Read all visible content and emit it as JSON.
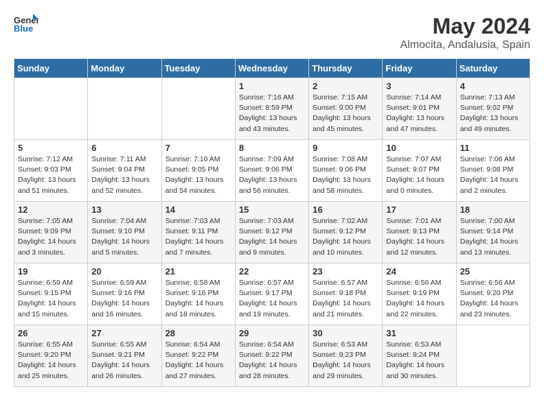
{
  "header": {
    "logo_general": "General",
    "logo_blue": "Blue",
    "title": "May 2024",
    "subtitle": "Almocita, Andalusia, Spain"
  },
  "days_of_week": [
    "Sunday",
    "Monday",
    "Tuesday",
    "Wednesday",
    "Thursday",
    "Friday",
    "Saturday"
  ],
  "weeks": [
    [
      {
        "day": "",
        "info": ""
      },
      {
        "day": "",
        "info": ""
      },
      {
        "day": "",
        "info": ""
      },
      {
        "day": "1",
        "info": "Sunrise: 7:16 AM\nSunset: 8:59 PM\nDaylight: 13 hours\nand 43 minutes."
      },
      {
        "day": "2",
        "info": "Sunrise: 7:15 AM\nSunset: 9:00 PM\nDaylight: 13 hours\nand 45 minutes."
      },
      {
        "day": "3",
        "info": "Sunrise: 7:14 AM\nSunset: 9:01 PM\nDaylight: 13 hours\nand 47 minutes."
      },
      {
        "day": "4",
        "info": "Sunrise: 7:13 AM\nSunset: 9:02 PM\nDaylight: 13 hours\nand 49 minutes."
      }
    ],
    [
      {
        "day": "5",
        "info": "Sunrise: 7:12 AM\nSunset: 9:03 PM\nDaylight: 13 hours\nand 51 minutes."
      },
      {
        "day": "6",
        "info": "Sunrise: 7:11 AM\nSunset: 9:04 PM\nDaylight: 13 hours\nand 52 minutes."
      },
      {
        "day": "7",
        "info": "Sunrise: 7:10 AM\nSunset: 9:05 PM\nDaylight: 13 hours\nand 54 minutes."
      },
      {
        "day": "8",
        "info": "Sunrise: 7:09 AM\nSunset: 9:06 PM\nDaylight: 13 hours\nand 56 minutes."
      },
      {
        "day": "9",
        "info": "Sunrise: 7:08 AM\nSunset: 9:06 PM\nDaylight: 13 hours\nand 58 minutes."
      },
      {
        "day": "10",
        "info": "Sunrise: 7:07 AM\nSunset: 9:07 PM\nDaylight: 14 hours\nand 0 minutes."
      },
      {
        "day": "11",
        "info": "Sunrise: 7:06 AM\nSunset: 9:08 PM\nDaylight: 14 hours\nand 2 minutes."
      }
    ],
    [
      {
        "day": "12",
        "info": "Sunrise: 7:05 AM\nSunset: 9:09 PM\nDaylight: 14 hours\nand 3 minutes."
      },
      {
        "day": "13",
        "info": "Sunrise: 7:04 AM\nSunset: 9:10 PM\nDaylight: 14 hours\nand 5 minutes."
      },
      {
        "day": "14",
        "info": "Sunrise: 7:03 AM\nSunset: 9:11 PM\nDaylight: 14 hours\nand 7 minutes."
      },
      {
        "day": "15",
        "info": "Sunrise: 7:03 AM\nSunset: 9:12 PM\nDaylight: 14 hours\nand 9 minutes."
      },
      {
        "day": "16",
        "info": "Sunrise: 7:02 AM\nSunset: 9:12 PM\nDaylight: 14 hours\nand 10 minutes."
      },
      {
        "day": "17",
        "info": "Sunrise: 7:01 AM\nSunset: 9:13 PM\nDaylight: 14 hours\nand 12 minutes."
      },
      {
        "day": "18",
        "info": "Sunrise: 7:00 AM\nSunset: 9:14 PM\nDaylight: 14 hours\nand 13 minutes."
      }
    ],
    [
      {
        "day": "19",
        "info": "Sunrise: 6:59 AM\nSunset: 9:15 PM\nDaylight: 14 hours\nand 15 minutes."
      },
      {
        "day": "20",
        "info": "Sunrise: 6:59 AM\nSunset: 9:16 PM\nDaylight: 14 hours\nand 16 minutes."
      },
      {
        "day": "21",
        "info": "Sunrise: 6:58 AM\nSunset: 9:16 PM\nDaylight: 14 hours\nand 18 minutes."
      },
      {
        "day": "22",
        "info": "Sunrise: 6:57 AM\nSunset: 9:17 PM\nDaylight: 14 hours\nand 19 minutes."
      },
      {
        "day": "23",
        "info": "Sunrise: 6:57 AM\nSunset: 9:18 PM\nDaylight: 14 hours\nand 21 minutes."
      },
      {
        "day": "24",
        "info": "Sunrise: 6:56 AM\nSunset: 9:19 PM\nDaylight: 14 hours\nand 22 minutes."
      },
      {
        "day": "25",
        "info": "Sunrise: 6:56 AM\nSunset: 9:20 PM\nDaylight: 14 hours\nand 23 minutes."
      }
    ],
    [
      {
        "day": "26",
        "info": "Sunrise: 6:55 AM\nSunset: 9:20 PM\nDaylight: 14 hours\nand 25 minutes."
      },
      {
        "day": "27",
        "info": "Sunrise: 6:55 AM\nSunset: 9:21 PM\nDaylight: 14 hours\nand 26 minutes."
      },
      {
        "day": "28",
        "info": "Sunrise: 6:54 AM\nSunset: 9:22 PM\nDaylight: 14 hours\nand 27 minutes."
      },
      {
        "day": "29",
        "info": "Sunrise: 6:54 AM\nSunset: 9:22 PM\nDaylight: 14 hours\nand 28 minutes."
      },
      {
        "day": "30",
        "info": "Sunrise: 6:53 AM\nSunset: 9:23 PM\nDaylight: 14 hours\nand 29 minutes."
      },
      {
        "day": "31",
        "info": "Sunrise: 6:53 AM\nSunset: 9:24 PM\nDaylight: 14 hours\nand 30 minutes."
      },
      {
        "day": "",
        "info": ""
      }
    ]
  ]
}
